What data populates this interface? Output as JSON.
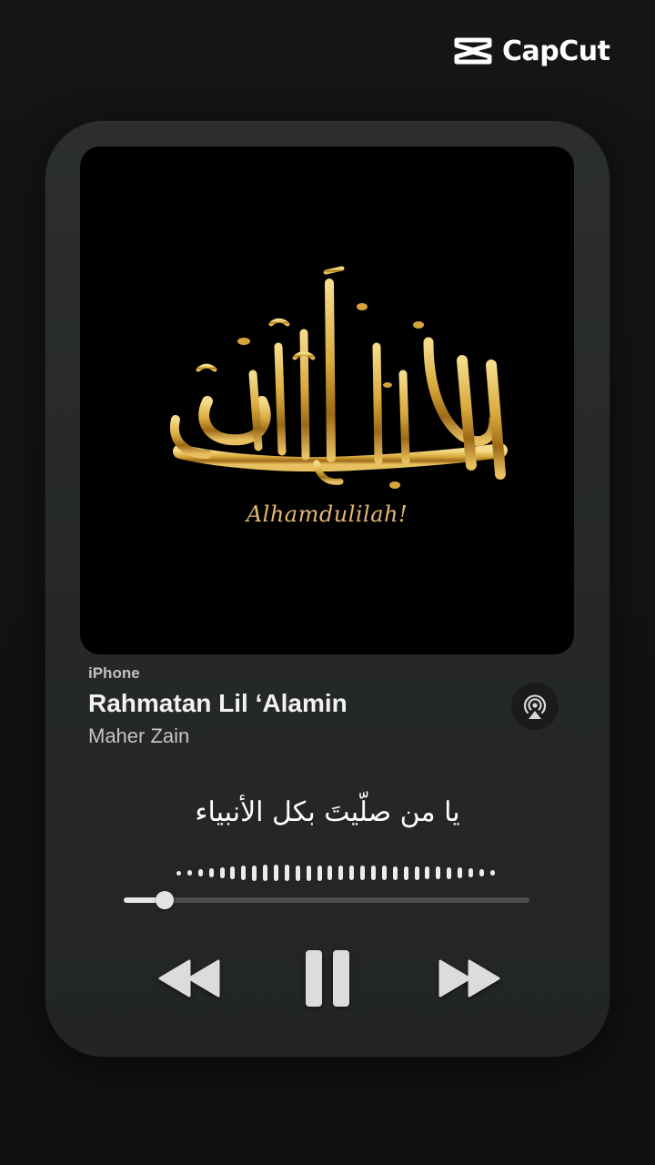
{
  "watermark": {
    "text": "CapCut",
    "icon": "capcut-logo-icon"
  },
  "artwork": {
    "caption": "Alhamdulilah!"
  },
  "now_playing": {
    "source": "iPhone",
    "title": "Rahmatan Lil ‘Alamin",
    "artist": "Maher Zain",
    "lyric": "يا من صلّيتَ بكل الأنبياء"
  },
  "playback": {
    "progress": 0.1,
    "state": "playing"
  },
  "icons": {
    "airplay": "airplay-audio-icon",
    "rewind": "rewind-icon",
    "pause": "pause-icon",
    "forward": "fast-forward-icon"
  },
  "colors": {
    "accent_gold": "#e3b873",
    "card": "#272a28",
    "text": "#f1f2f1"
  }
}
